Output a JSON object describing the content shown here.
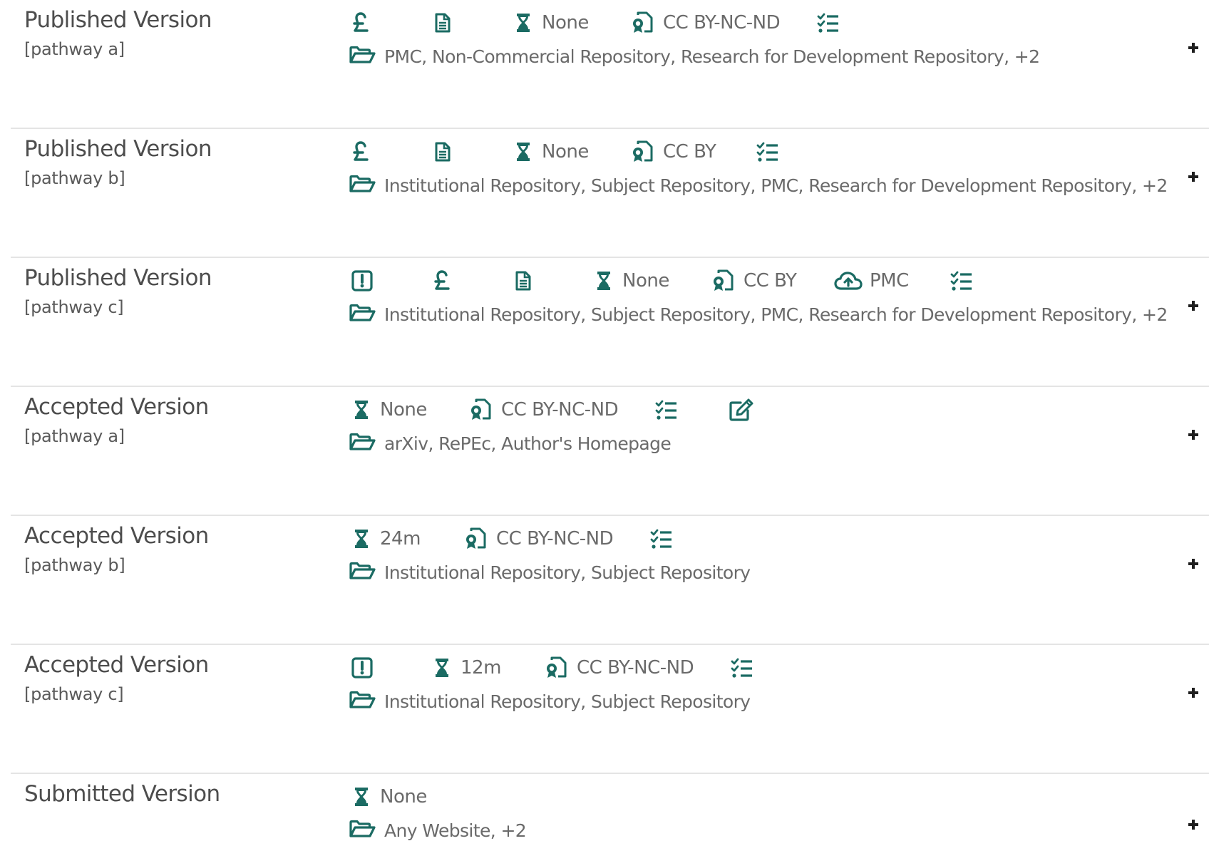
{
  "rows": [
    {
      "title": "Published Version",
      "pathway": "[pathway a]",
      "embargo": "None",
      "license": "CC BY-NC-ND",
      "repositories": "PMC, Non-Commercial Repository, Research for Development Repository, +2"
    },
    {
      "title": "Published Version",
      "pathway": "[pathway b]",
      "embargo": "None",
      "license": "CC BY",
      "repositories": "Institutional Repository, Subject Repository, PMC, Research for Development Repository, +2"
    },
    {
      "title": "Published Version",
      "pathway": "[pathway c]",
      "embargo": "None",
      "license": "CC BY",
      "deposit": "PMC",
      "repositories": "Institutional Repository, Subject Repository, PMC, Research for Development Repository, +2"
    },
    {
      "title": "Accepted Version",
      "pathway": "[pathway a]",
      "embargo": "None",
      "license": "CC BY-NC-ND",
      "repositories": "arXiv, RePEc, Author's Homepage"
    },
    {
      "title": "Accepted Version",
      "pathway": "[pathway b]",
      "embargo": "24m",
      "license": "CC BY-NC-ND",
      "repositories": "Institutional Repository, Subject Repository"
    },
    {
      "title": "Accepted Version",
      "pathway": "[pathway c]",
      "embargo": "12m",
      "license": "CC BY-NC-ND",
      "repositories": "Institutional Repository, Subject Repository"
    },
    {
      "title": "Submitted Version",
      "pathway": "",
      "embargo": "None",
      "repositories": "Any Website, +2"
    }
  ],
  "icons": {
    "fee": "pound-icon",
    "copyright": "document-icon",
    "embargo": "hourglass-icon",
    "license": "license-icon",
    "conditions": "checklist-icon",
    "prerequisite": "exclamation-icon",
    "deposit": "cloud-upload-icon",
    "edit": "edit-icon",
    "repositories": "folder-icon",
    "expand": "plus-icon"
  },
  "colors": {
    "accent": "#1b6b63",
    "title": "#4d4d4d",
    "text": "#6a6a6a",
    "divider": "#e4e4e4"
  }
}
